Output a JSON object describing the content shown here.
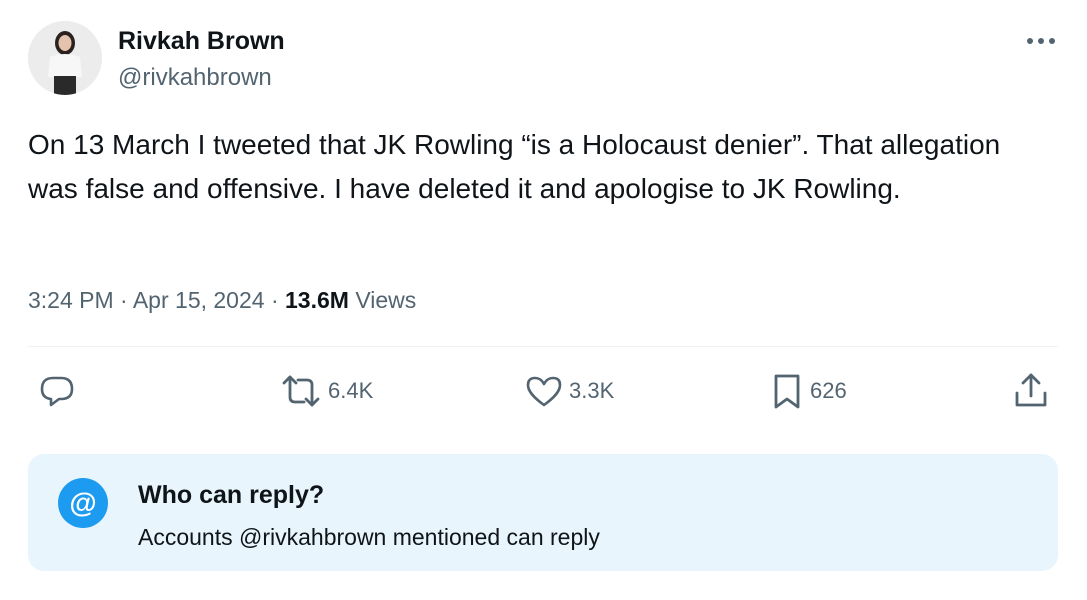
{
  "author": {
    "display_name": "Rivkah Brown",
    "handle": "@rivkahbrown"
  },
  "tweet": {
    "text": "On 13 March I tweeted that JK Rowling “is a Holocaust denier”. That allegation was false and offensive. I have deleted it and apologise to JK Rowling.",
    "time": "3:24 PM",
    "separator": "·",
    "date": "Apr 15, 2024",
    "views_count": "13.6M",
    "views_label": "Views"
  },
  "actions": {
    "reply_count": "",
    "retweet_count": "6.4K",
    "like_count": "3.3K",
    "bookmark_count": "626"
  },
  "icons": {
    "more": "more-icon",
    "reply": "reply-icon",
    "retweet": "retweet-icon",
    "like": "heart-icon",
    "bookmark": "bookmark-icon",
    "share": "share-icon",
    "mention": "at-icon"
  },
  "reply_restriction": {
    "icon_glyph": "@",
    "title": "Who can reply?",
    "description": "Accounts @rivkahbrown mentioned can reply"
  },
  "colors": {
    "accent": "#1d9bf0",
    "secondary_text": "#536471",
    "primary_text": "#0f1419",
    "reply_box_bg": "#e8f5fd"
  }
}
